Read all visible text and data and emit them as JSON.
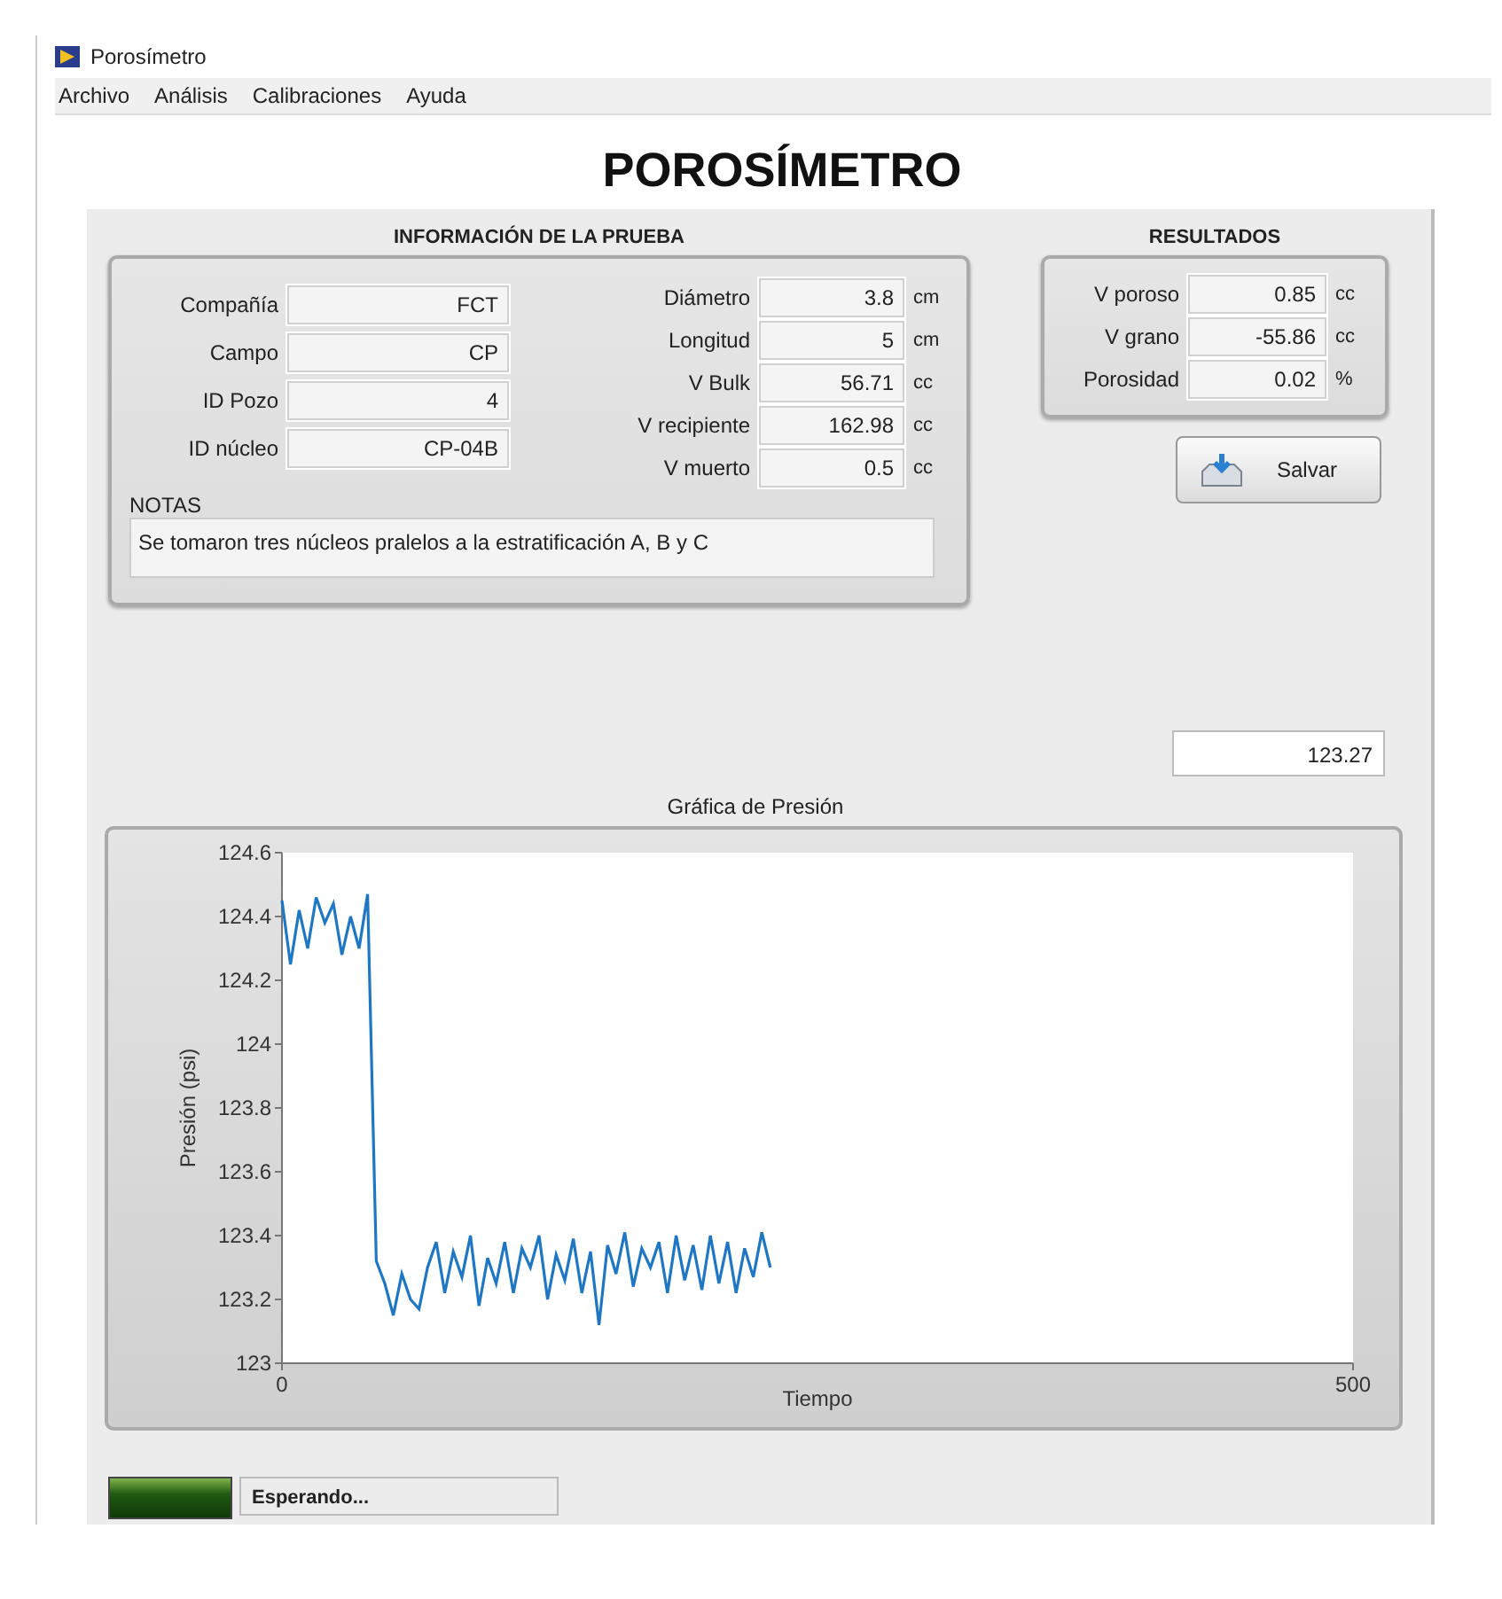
{
  "window": {
    "title": "Porosímetro"
  },
  "menu": [
    "Archivo",
    "Análisis",
    "Calibraciones",
    "Ayuda"
  ],
  "heading": "POROSÍMETRO",
  "test_info": {
    "title": "INFORMACIÓN DE LA PRUEBA",
    "fields": [
      {
        "label": "Compañía",
        "value": "FCT"
      },
      {
        "label": "Campo",
        "value": "CP"
      },
      {
        "label": "ID Pozo",
        "value": "4"
      },
      {
        "label": "ID núcleo",
        "value": "CP-04B"
      }
    ],
    "measurements": [
      {
        "label": "Diámetro",
        "value": "3.8",
        "unit": "cm"
      },
      {
        "label": "Longitud",
        "value": "5",
        "unit": "cm"
      },
      {
        "label": "V Bulk",
        "value": "56.71",
        "unit": "cc"
      },
      {
        "label": "V recipiente",
        "value": "162.98",
        "unit": "cc"
      },
      {
        "label": "V muerto",
        "value": "0.5",
        "unit": "cc"
      }
    ],
    "notes": {
      "label": "NOTAS",
      "value": "Se tomaron tres núcleos pralelos a la estratificación A, B y C"
    }
  },
  "results": {
    "title": "RESULTADOS",
    "rows": [
      {
        "label": "V poroso",
        "value": "0.85",
        "unit": "cc"
      },
      {
        "label": "V grano",
        "value": "-55.86",
        "unit": "cc"
      },
      {
        "label": "Porosidad",
        "value": "0.02",
        "unit": "%"
      }
    ],
    "save_button": "Salvar"
  },
  "pressure_display": "123.27",
  "chart_data": {
    "type": "line",
    "title": "Gráfica de Presión",
    "xlabel": "Tiempo",
    "ylabel": "Presión (psi)",
    "x": [
      0,
      4,
      8,
      12,
      16,
      20,
      24,
      28,
      32,
      36,
      40,
      44,
      48,
      52,
      56,
      60,
      64,
      68,
      72,
      76,
      80,
      84,
      88,
      92,
      96,
      100,
      104,
      108,
      112,
      116,
      120,
      124,
      128,
      132,
      136,
      140,
      144,
      148,
      152,
      156,
      160,
      164,
      168,
      172,
      176,
      180,
      184,
      188,
      192,
      196,
      200,
      204,
      208,
      212,
      216,
      220,
      224,
      228
    ],
    "series": [
      {
        "color": "#1f77c4",
        "values": [
          124.45,
          124.25,
          124.42,
          124.3,
          124.46,
          124.38,
          124.44,
          124.28,
          124.4,
          124.3,
          124.47,
          123.32,
          123.25,
          123.15,
          123.28,
          123.2,
          123.17,
          123.3,
          123.38,
          123.22,
          123.35,
          123.27,
          123.4,
          123.18,
          123.33,
          123.25,
          123.38,
          123.22,
          123.36,
          123.3,
          123.4,
          123.2,
          123.34,
          123.26,
          123.39,
          123.22,
          123.35,
          123.12,
          123.37,
          123.28,
          123.41,
          123.24,
          123.36,
          123.3,
          123.38,
          123.22,
          123.4,
          123.26,
          123.37,
          123.23,
          123.4,
          123.25,
          123.38,
          123.22,
          123.36,
          123.27,
          123.41,
          123.3
        ]
      }
    ],
    "xlim": [
      0,
      500
    ],
    "ylim": [
      123,
      124.6
    ],
    "xticks": [
      0,
      500
    ],
    "yticks": [
      123,
      123.2,
      123.4,
      123.6,
      123.8,
      124,
      124.2,
      124.4,
      124.6
    ]
  },
  "status": {
    "led_on": true,
    "text": "Esperando..."
  }
}
